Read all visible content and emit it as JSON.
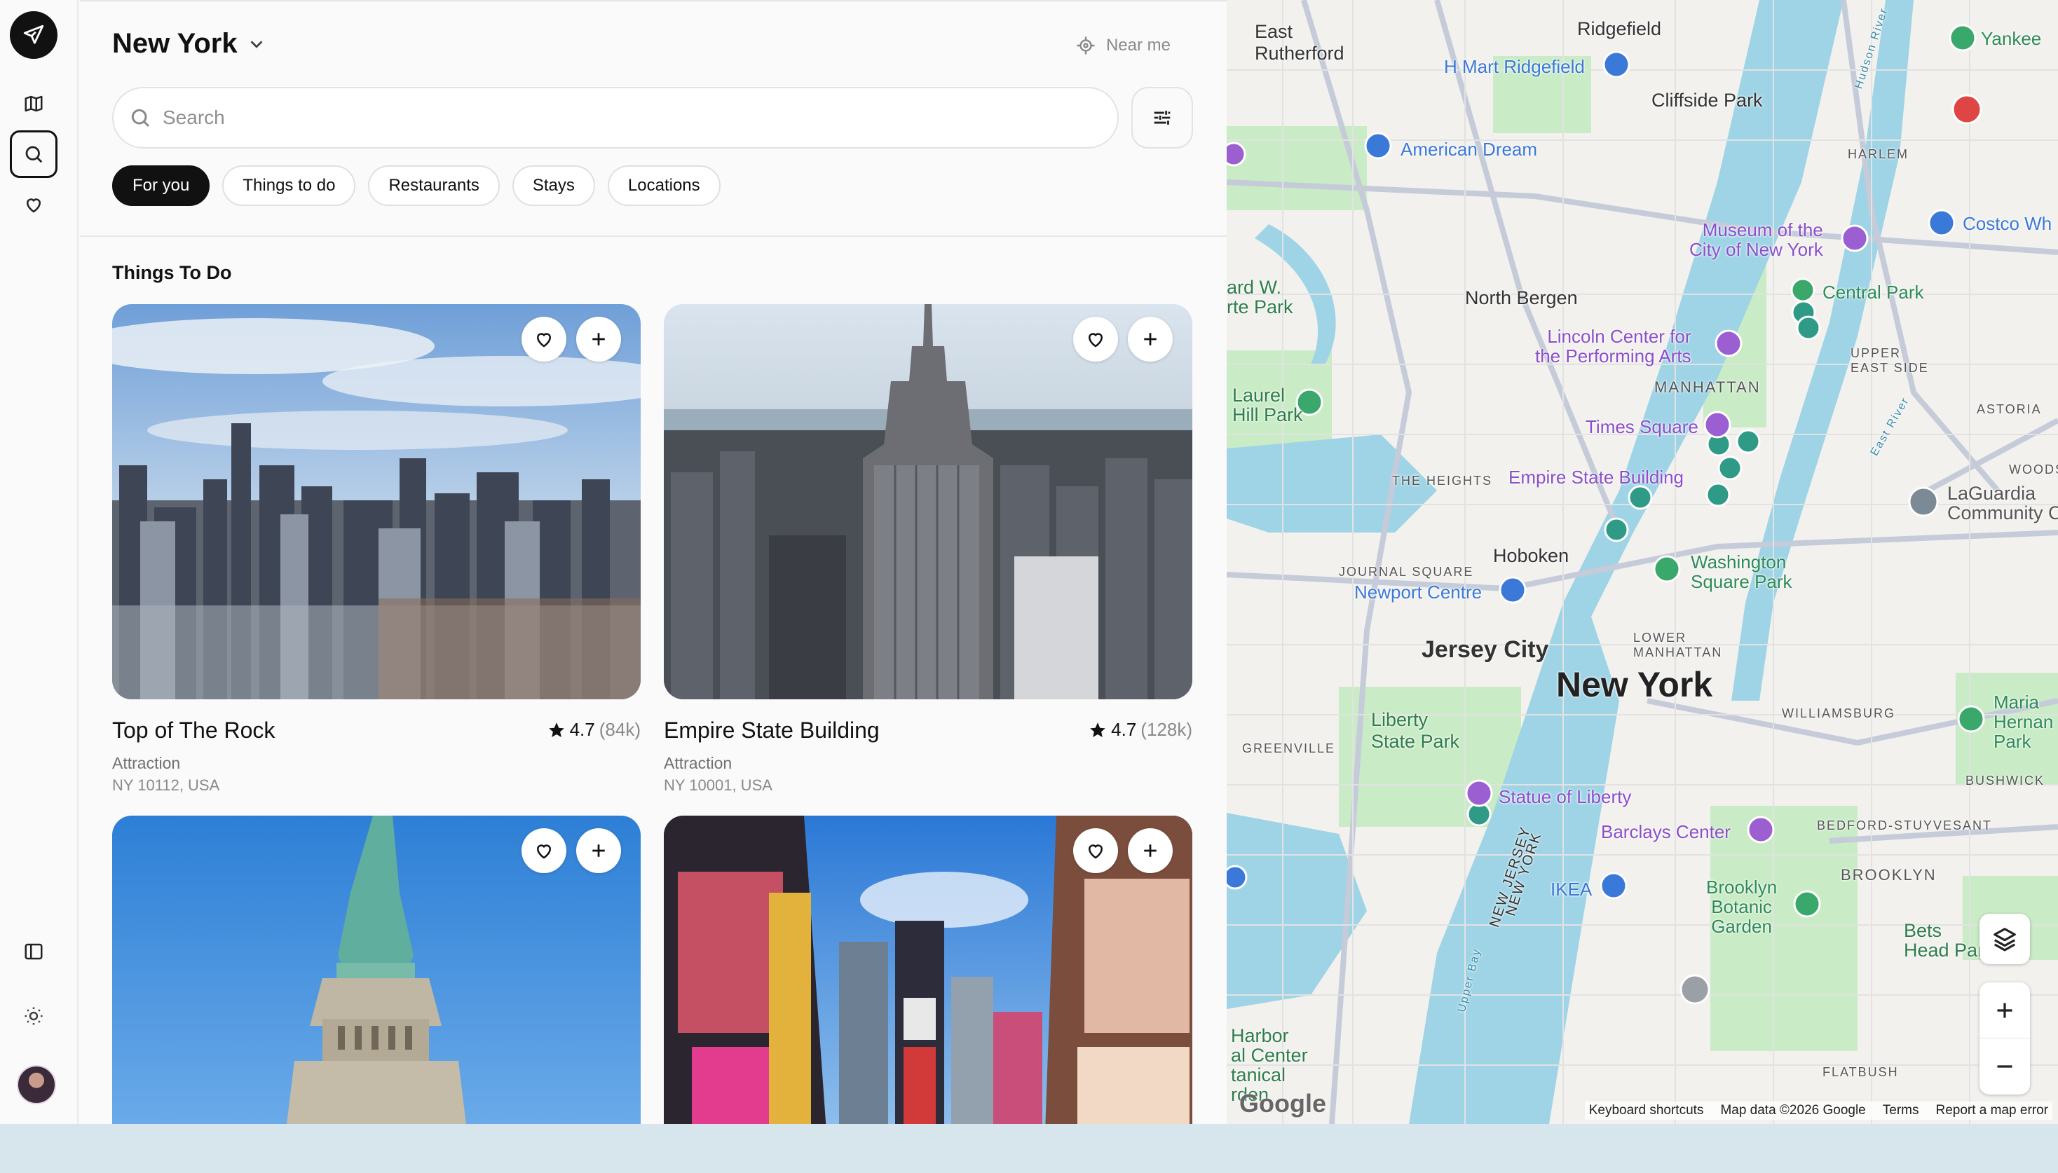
{
  "rail": {
    "logo_icon": "plane-icon",
    "items": [
      "map-icon",
      "search-icon",
      "heart-icon"
    ],
    "bottom": [
      "sidebar-toggle-icon",
      "sun-icon"
    ]
  },
  "header": {
    "city": "New York",
    "near_me": "Near me"
  },
  "search": {
    "placeholder": "Search"
  },
  "chips": [
    "For you",
    "Things to do",
    "Restaurants",
    "Stays",
    "Locations"
  ],
  "section_title": "Things To Do",
  "cards": [
    {
      "title": "Top of The Rock",
      "rating": "4.7",
      "count": "(84k)",
      "type": "Attraction",
      "address": "NY 10112, USA"
    },
    {
      "title": "Empire State Building",
      "rating": "4.7",
      "count": "(128k)",
      "type": "Attraction",
      "address": "NY 10001, USA"
    },
    {
      "title": "",
      "rating": "",
      "count": "",
      "type": "",
      "address": ""
    },
    {
      "title": "",
      "rating": "",
      "count": "",
      "type": "",
      "address": ""
    }
  ],
  "map": {
    "labels": {
      "new_york": "New York",
      "jersey_city": "Jersey City",
      "hoboken": "Hoboken",
      "north_bergen": "North Bergen",
      "manhattan": "MANHATTAN",
      "ridgefield": "Ridgefield",
      "cliffside": "Cliffside Park",
      "east_rutherford": "East\nRutherford",
      "harlem": "HARLEM",
      "upper_east": "UPPER\nEAST SIDE",
      "astoria": "ASTORIA",
      "woodside": "WOODSI",
      "the_heights": "THE HEIGHTS",
      "journal_square": "JOURNAL SQUARE",
      "lower_manhattan": "LOWER\nMANHATTAN",
      "williamsburg": "WILLIAMSBURG",
      "greenville": "GREENVILLE",
      "bushwick": "BUSHWICK",
      "bedford": "BEDFORD-STUYVESANT",
      "brooklyn": "BROOKLYN",
      "flatbush": "FLATBUSH",
      "liberty_park": "Liberty\nState Park",
      "nj": "NEW JERSEY",
      "ny": "NEW YORK",
      "hudson": "Hudson River",
      "east_river": "East River",
      "upper_bay": "Upper Bay"
    },
    "pois": {
      "hmart": "H Mart Ridgefield",
      "american_dream": "American Dream",
      "museum": "Museum of the\nCity of New York",
      "costco": "Costco Wh",
      "central_park": "Central Park",
      "lincoln": "Lincoln Center for\nthe Performing Arts",
      "times_square": "Times Square",
      "empire": "Empire State Building",
      "washington": "Washington\nSquare Park",
      "newport": "Newport Centre",
      "statue": "Statue of Liberty",
      "barclays": "Barclays Center",
      "ikea": "IKEA",
      "botanic": "Brooklyn\nBotanic\nGarden",
      "laguardia": "LaGuardia\nCommunity C",
      "maria": "Maria\nHernan\nPark",
      "yankee": "Yankee",
      "laurel": "Laurel\nHill Park",
      "harbor": "Harbor\nal Center\ntanical\nrden",
      "beds": "Bets\nHead Par",
      "ward": "ard W.\nrte Park"
    },
    "footer": {
      "shortcuts": "Keyboard shortcuts",
      "map_data": "Map data ©2026 Google",
      "terms": "Terms",
      "report": "Report a map error"
    },
    "logo": "Google"
  },
  "colors": {
    "accent": "#111111",
    "water": "#9fd4e6",
    "park": "#c9ebc6",
    "pin_teal": "#2f9a86",
    "poi_purple": "#9b5fd1",
    "poi_blue": "#3a79d8"
  }
}
